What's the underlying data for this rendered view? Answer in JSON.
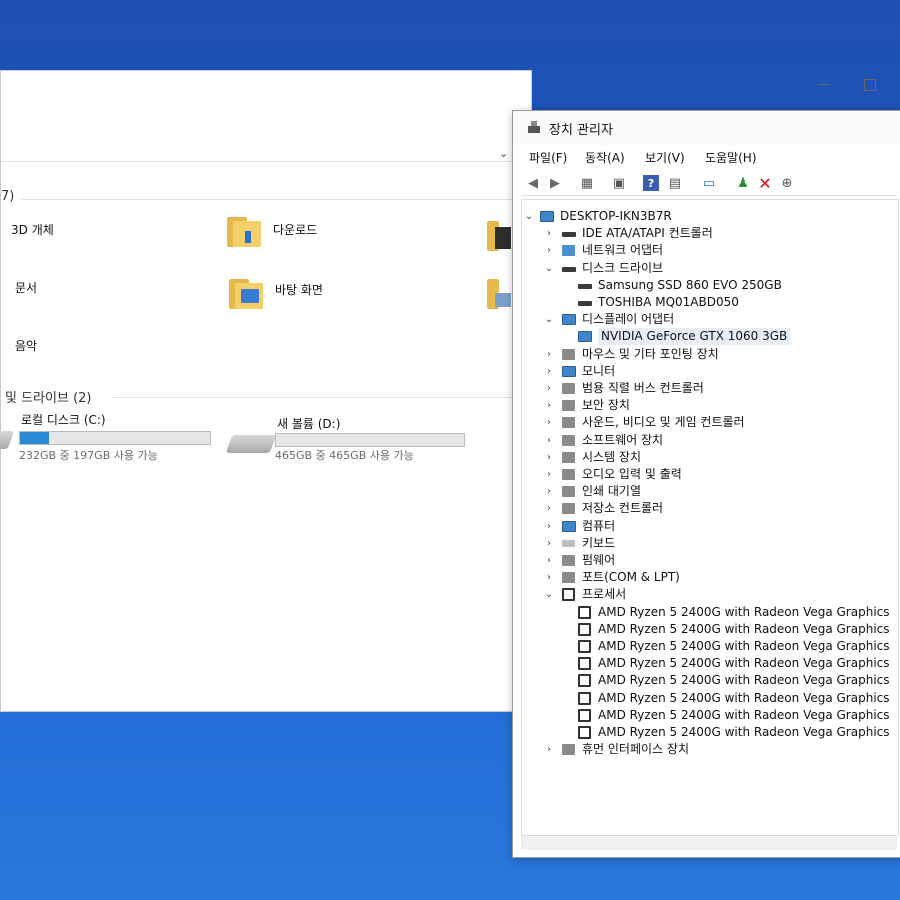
{
  "explorer": {
    "count_fragment": "7)",
    "folders": [
      {
        "label": "3D 개체"
      },
      {
        "label": "다운로드"
      },
      {
        "label": "문서"
      },
      {
        "label": "바탕 화면"
      },
      {
        "label": "음악"
      }
    ],
    "drives_heading": "및 드라이브 (2)",
    "drives": [
      {
        "label": "로컬 디스크 (C:)",
        "detail": "232GB 중 197GB 사용 가능",
        "used_fraction": 0.15
      },
      {
        "label": "새 볼륨 (D:)",
        "detail": "465GB 중 465GB 사용 가능",
        "used_fraction": 0.0
      }
    ]
  },
  "device_manager": {
    "title": "장치 관리자",
    "menu": [
      "파일(F)",
      "동작(A)",
      "보기(V)",
      "도움말(H)"
    ],
    "tree": [
      {
        "level": 0,
        "expander": "open",
        "icon": "computer-icon",
        "label": "DESKTOP-IKN3B7R"
      },
      {
        "level": 1,
        "expander": "closed",
        "icon": "disk-controller-icon",
        "label": "IDE ATA/ATAPI 컨트롤러"
      },
      {
        "level": 1,
        "expander": "closed",
        "icon": "network-icon",
        "label": "네트워크 어댑터"
      },
      {
        "level": 1,
        "expander": "open",
        "icon": "disk-icon",
        "label": "디스크 드라이브"
      },
      {
        "level": 2,
        "expander": "none",
        "icon": "disk-icon",
        "label": "Samsung SSD 860 EVO 250GB"
      },
      {
        "level": 2,
        "expander": "none",
        "icon": "disk-icon",
        "label": "TOSHIBA MQ01ABD050"
      },
      {
        "level": 1,
        "expander": "open",
        "icon": "monitor-icon",
        "label": "디스플레이 어댑터"
      },
      {
        "level": 2,
        "expander": "none",
        "icon": "monitor-icon",
        "label": "NVIDIA GeForce GTX 1060 3GB",
        "selected": true
      },
      {
        "level": 1,
        "expander": "closed",
        "icon": "mouse-icon",
        "label": "마우스 및 기타 포인팅 장치"
      },
      {
        "level": 1,
        "expander": "closed",
        "icon": "monitor-icon",
        "label": "모니터"
      },
      {
        "level": 1,
        "expander": "closed",
        "icon": "usb-icon",
        "label": "범용 직렬 버스 컨트롤러"
      },
      {
        "level": 1,
        "expander": "closed",
        "icon": "security-icon",
        "label": "보안 장치"
      },
      {
        "level": 1,
        "expander": "closed",
        "icon": "speaker-icon",
        "label": "사운드, 비디오 및 게임 컨트롤러"
      },
      {
        "level": 1,
        "expander": "closed",
        "icon": "software-icon",
        "label": "소프트웨어 장치"
      },
      {
        "level": 1,
        "expander": "closed",
        "icon": "system-icon",
        "label": "시스템 장치"
      },
      {
        "level": 1,
        "expander": "closed",
        "icon": "audio-icon",
        "label": "오디오 입력 및 출력"
      },
      {
        "level": 1,
        "expander": "closed",
        "icon": "printer-icon",
        "label": "인쇄 대기열"
      },
      {
        "level": 1,
        "expander": "closed",
        "icon": "storage-icon",
        "label": "저장소 컨트롤러"
      },
      {
        "level": 1,
        "expander": "closed",
        "icon": "monitor-icon",
        "label": "컴퓨터"
      },
      {
        "level": 1,
        "expander": "closed",
        "icon": "keyboard-icon",
        "label": "키보드"
      },
      {
        "level": 1,
        "expander": "closed",
        "icon": "firmware-icon",
        "label": "펌웨어"
      },
      {
        "level": 1,
        "expander": "closed",
        "icon": "port-icon",
        "label": "포트(COM & LPT)"
      },
      {
        "level": 1,
        "expander": "open",
        "icon": "cpu-icon",
        "label": "프로세서"
      },
      {
        "level": 2,
        "expander": "none",
        "icon": "cpu-icon",
        "label": "AMD Ryzen 5 2400G with Radeon Vega Graphics"
      },
      {
        "level": 2,
        "expander": "none",
        "icon": "cpu-icon",
        "label": "AMD Ryzen 5 2400G with Radeon Vega Graphics"
      },
      {
        "level": 2,
        "expander": "none",
        "icon": "cpu-icon",
        "label": "AMD Ryzen 5 2400G with Radeon Vega Graphics"
      },
      {
        "level": 2,
        "expander": "none",
        "icon": "cpu-icon",
        "label": "AMD Ryzen 5 2400G with Radeon Vega Graphics"
      },
      {
        "level": 2,
        "expander": "none",
        "icon": "cpu-icon",
        "label": "AMD Ryzen 5 2400G with Radeon Vega Graphics"
      },
      {
        "level": 2,
        "expander": "none",
        "icon": "cpu-icon",
        "label": "AMD Ryzen 5 2400G with Radeon Vega Graphics"
      },
      {
        "level": 2,
        "expander": "none",
        "icon": "cpu-icon",
        "label": "AMD Ryzen 5 2400G with Radeon Vega Graphics"
      },
      {
        "level": 2,
        "expander": "none",
        "icon": "cpu-icon",
        "label": "AMD Ryzen 5 2400G with Radeon Vega Graphics"
      },
      {
        "level": 1,
        "expander": "closed",
        "icon": "hid-icon",
        "label": "휴먼 인터페이스 장치"
      }
    ]
  },
  "colors": {
    "desktop": "#1e5cc4",
    "drive_fill": "#2b8ad6",
    "selection": "#e7eef7"
  }
}
